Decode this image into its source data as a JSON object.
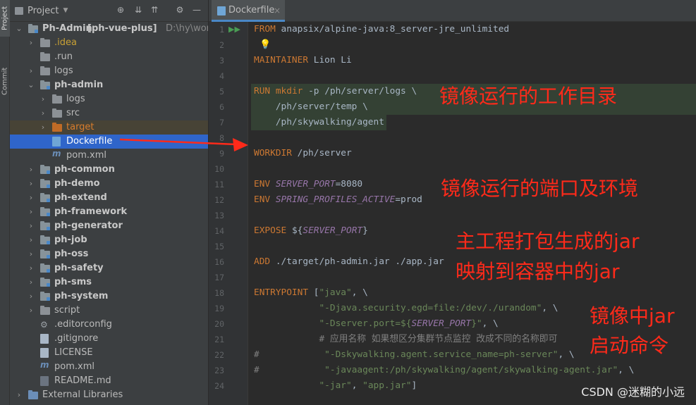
{
  "window": {
    "vertical_tabs": {
      "project": "Project",
      "commit": "Commit"
    }
  },
  "project_panel": {
    "title": "Project",
    "icons": [
      "globe-icon",
      "collapse-icon",
      "expand-icon",
      "settings-icon",
      "minimize-icon"
    ],
    "tree": [
      {
        "label": "Ph-Admin",
        "bold": true,
        "suffix": "[ph-vue-plus]",
        "path": "D:\\hy\\workspace",
        "expanded": true,
        "icon": "module-folder"
      },
      {
        "label": ".idea",
        "icon": "folder",
        "color": "#c8a035"
      },
      {
        "label": ".run",
        "icon": "folder",
        "leaf": true
      },
      {
        "label": "logs",
        "icon": "folder"
      },
      {
        "label": "ph-admin",
        "bold": true,
        "icon": "module-folder",
        "expanded": true
      },
      {
        "label": "logs",
        "icon": "folder"
      },
      {
        "label": "src",
        "icon": "folder"
      },
      {
        "label": "target",
        "icon": "folder-orange",
        "color": "#d97d2c",
        "selected_bg": "#474336"
      },
      {
        "label": "Dockerfile",
        "icon": "docker-file",
        "selected": true
      },
      {
        "label": "pom.xml",
        "icon": "maven-file"
      },
      {
        "label": "ph-common",
        "bold": true,
        "icon": "module-folder"
      },
      {
        "label": "ph-demo",
        "bold": true,
        "icon": "module-folder"
      },
      {
        "label": "ph-extend",
        "bold": true,
        "icon": "module-folder"
      },
      {
        "label": "ph-framework",
        "bold": true,
        "icon": "module-folder"
      },
      {
        "label": "ph-generator",
        "bold": true,
        "icon": "module-folder"
      },
      {
        "label": "ph-job",
        "bold": true,
        "icon": "module-folder"
      },
      {
        "label": "ph-oss",
        "bold": true,
        "icon": "module-folder"
      },
      {
        "label": "ph-safety",
        "bold": true,
        "icon": "module-folder"
      },
      {
        "label": "ph-sms",
        "bold": true,
        "icon": "module-folder"
      },
      {
        "label": "ph-system",
        "bold": true,
        "icon": "module-folder"
      },
      {
        "label": "script",
        "icon": "folder"
      },
      {
        "label": ".editorconfig",
        "icon": "gear-file"
      },
      {
        "label": ".gitignore",
        "icon": "text-file"
      },
      {
        "label": "LICENSE",
        "icon": "text-file"
      },
      {
        "label": "pom.xml",
        "icon": "maven-file"
      },
      {
        "label": "README.md",
        "icon": "markdown-file"
      },
      {
        "label": "External Libraries",
        "icon": "library"
      }
    ]
  },
  "editor": {
    "tab": {
      "label": "Dockerfile",
      "close": "×"
    },
    "lines": [
      {
        "n": "1",
        "html": "<span class='kw'>FROM</span> anapsix/alpine-java:8_server-jre_unlimited"
      },
      {
        "n": "2",
        "html": ""
      },
      {
        "n": "3",
        "html": "<span class='kw'>MAINTAINER</span> Lion Li"
      },
      {
        "n": "4",
        "html": ""
      },
      {
        "n": "5",
        "html": "<span class='kw'>RUN</span> <span class='kw'>mkdir</span> -p /ph/server/logs \\",
        "hl": true
      },
      {
        "n": "6",
        "html": "    /ph/server/temp \\",
        "hl": true
      },
      {
        "n": "7",
        "html": "    /ph/skywalking/agent",
        "hl": true
      },
      {
        "n": "8",
        "html": ""
      },
      {
        "n": "9",
        "html": "<span class='kw'>WORKDIR</span> /ph/server"
      },
      {
        "n": "10",
        "html": ""
      },
      {
        "n": "11",
        "html": "<span class='kw'>ENV</span> <span class='it'>SERVER_PORT</span>=8080"
      },
      {
        "n": "12",
        "html": "<span class='kw'>ENV</span> <span class='it'>SPRING_PROFILES_ACTIVE</span>=prod"
      },
      {
        "n": "13",
        "html": ""
      },
      {
        "n": "14",
        "html": "<span class='kw'>EXPOSE</span> ${<span class='it'>SERVER_PORT</span>}"
      },
      {
        "n": "15",
        "html": ""
      },
      {
        "n": "16",
        "html": "<span class='kw'>ADD</span> ./target/ph-admin.jar ./app.jar"
      },
      {
        "n": "17",
        "html": ""
      },
      {
        "n": "18",
        "html": "<span class='kw'>ENTRYPOINT</span> [<span class='str'>\"java\"</span>, \\"
      },
      {
        "n": "19",
        "html": "            <span class='str'>\"-Djava.security.egd=file:/dev/./urandom\"</span>, \\"
      },
      {
        "n": "20",
        "html": "            <span class='str'>\"-Dserver.port=${</span><span class='it'>SERVER_PORT</span><span class='str'>}\"</span>, \\"
      },
      {
        "n": "21",
        "html": "            <span class='cm'># 应用名称 如果想区分集群节点监控 改成不同的名称即可</span>"
      },
      {
        "n": "22",
        "html": "<span class='cm'>#</span>            <span class='str'>\"-Dskywalking.agent.service_name=ph-server\"</span>, \\"
      },
      {
        "n": "23",
        "html": "<span class='cm'>#</span>            <span class='str'>\"-javaagent:/ph/skywalking/agent/skywalking-agent.jar\"</span>, \\"
      },
      {
        "n": "24",
        "html": "            <span class='str'>\"-jar\"</span>, <span class='str'>\"app.jar\"</span>]"
      }
    ]
  },
  "annotations": {
    "a1": "镜像运行的工作目录",
    "a2": "镜像运行的端口及环境",
    "a3_l1": "主工程打包生成的jar",
    "a3_l2": "映射到容器中的jar",
    "a4_l1": "镜像中jar",
    "a4_l2": "启动命令"
  },
  "watermark": "CSDN @迷糊的小远",
  "colors": {
    "arrow": "#ff2a1a",
    "selection": "#2f65ca",
    "annotation": "#ff2a1a"
  }
}
